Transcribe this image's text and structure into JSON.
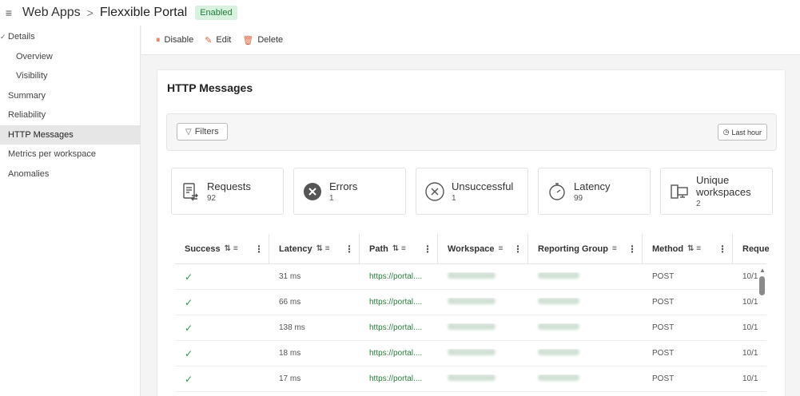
{
  "header": {
    "breadcrumb": "Web Apps",
    "title": "Flexxible Portal",
    "badge": "Enabled"
  },
  "sidebar": {
    "items": [
      {
        "label": "Details"
      },
      {
        "label": "Overview"
      },
      {
        "label": "Visibility"
      },
      {
        "label": "Summary"
      },
      {
        "label": "Reliability"
      },
      {
        "label": "HTTP Messages"
      },
      {
        "label": "Metrics per workspace"
      },
      {
        "label": "Anomalies"
      }
    ]
  },
  "toolbar": {
    "disable": "Disable",
    "edit": "Edit",
    "delete": "Delete"
  },
  "main": {
    "title": "HTTP Messages",
    "filters_label": "Filters",
    "time_label": "Last hour",
    "stats": [
      {
        "label": "Requests",
        "value": "92"
      },
      {
        "label": "Errors",
        "value": "1"
      },
      {
        "label": "Unsuccessful",
        "value": "1"
      },
      {
        "label": "Latency",
        "value": "99"
      },
      {
        "label": "Unique workspaces",
        "value": "2"
      }
    ]
  },
  "table": {
    "columns": [
      "Success",
      "Latency",
      "Path",
      "Workspace",
      "Reporting Group",
      "Method",
      "Reque"
    ],
    "rows": [
      {
        "latency": "31 ms",
        "path": "https://portal....",
        "method": "POST",
        "date": "10/1"
      },
      {
        "latency": "66 ms",
        "path": "https://portal....",
        "method": "POST",
        "date": "10/1"
      },
      {
        "latency": "138 ms",
        "path": "https://portal....",
        "method": "POST",
        "date": "10/1"
      },
      {
        "latency": "18 ms",
        "path": "https://portal....",
        "method": "POST",
        "date": "10/1"
      },
      {
        "latency": "17 ms",
        "path": "https://portal....",
        "method": "POST",
        "date": "10/1"
      }
    ]
  },
  "colors": {
    "accent": "#d9623b",
    "success": "#2e9e4a",
    "badge_bg": "#d9f2df",
    "badge_fg": "#1c7c3a"
  },
  "icons": [
    "hamburger-icon",
    "chevron-right-icon",
    "pause-icon",
    "pencil-icon",
    "trash-icon",
    "filter-icon",
    "clock-icon",
    "requests-icon",
    "error-icon",
    "unsuccessful-icon",
    "stopwatch-icon",
    "workspaces-icon",
    "sort-icon",
    "kebab-icon",
    "check-icon"
  ]
}
